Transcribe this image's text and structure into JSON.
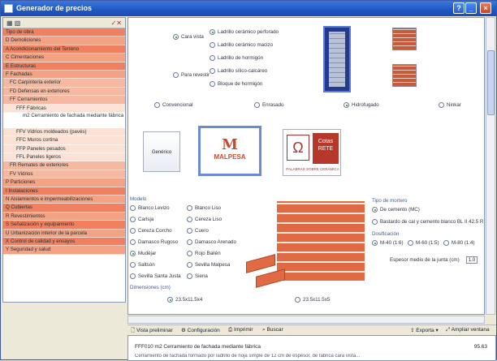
{
  "window": {
    "title": "Generador de precios"
  },
  "left_toolbar": {
    "left": "▦ ▧",
    "right": "✓✕"
  },
  "tree": [
    {
      "label": "Tipo de obra",
      "level": 0
    },
    {
      "label": "D  Demoliciones",
      "level": 0
    },
    {
      "label": "A  Acondicionamiento del Terreno",
      "level": 0
    },
    {
      "label": "C  Cimentaciones",
      "level": 0
    },
    {
      "label": "E  Estructuras",
      "level": 0
    },
    {
      "label": "F  Fachadas",
      "level": 0
    },
    {
      "label": "FC   Carpintería exterior",
      "level": 1
    },
    {
      "label": "FD   Defensas en exteriores",
      "level": 1
    },
    {
      "label": "FF   Cerramientos",
      "level": 1
    },
    {
      "label": "FFF   Fábricas",
      "level": 2
    },
    {
      "label": "m2  Cerramiento de fachada mediante fábrica",
      "level": "sel"
    },
    {
      "label": "FFV   Vidrios moldeados (pavés)",
      "level": 2
    },
    {
      "label": "FFC   Muros cortina",
      "level": 2
    },
    {
      "label": "FFP   Paneles pesados",
      "level": 2
    },
    {
      "label": "FFL   Paneles ligeros",
      "level": 2
    },
    {
      "label": "FR   Remates de exteriores",
      "level": 1
    },
    {
      "label": "FV   Vidrios",
      "level": 1
    },
    {
      "label": "P  Particiones",
      "level": 0
    },
    {
      "label": "I  Instalaciones",
      "level": 0
    },
    {
      "label": "N  Aislamientos e impermeabilizaciones",
      "level": 0
    },
    {
      "label": "Q  Cubiertas",
      "level": 0
    },
    {
      "label": "R  Revestimientos",
      "level": 0
    },
    {
      "label": "S  Señalización y equipamiento",
      "level": 0
    },
    {
      "label": "U  Urbanización interior de la parcela",
      "level": 0
    },
    {
      "label": "X  Control de calidad y ensayos",
      "level": 0
    },
    {
      "label": "Y  Seguridad y salud",
      "level": 0
    }
  ],
  "options_top": {
    "cara_vista": "Cara vista",
    "para_revestir": "Para revestir",
    "ladrillos": [
      "Ladrillo cerámico perforado",
      "Ladrillo cerámico macizo",
      "Ladrillo de hormigón",
      "Ladrillo sílico-calcáreo",
      "Bloque de hormigón"
    ]
  },
  "juntas": [
    "Convencional",
    "Enrasado",
    "Hidrofugado",
    "Ninkar"
  ],
  "logos": {
    "generico": "Genérico",
    "malpesa": "MALPESA",
    "asoc_line1": "Cotas",
    "asoc_line2": "RETE",
    "asoc_bottom": "PALABRAS SOBRE CERÁMICA"
  },
  "modelo": {
    "label": "Modelo",
    "col1": [
      "Blanco Levizo",
      "Carlsja",
      "Cereza Corcho",
      "Damasco Rugoso",
      "Mudéjar",
      "Saltsón",
      "Sevilla Santa Justa"
    ],
    "col2": [
      "Blanco Liso",
      "Cereza Liso",
      "Cuero",
      "Damasco Arenado",
      "Rojo Bailén",
      "Sevilla Malpesa",
      "Siena"
    ]
  },
  "mortero": {
    "label": "Tipo de mortero",
    "options": [
      "De cemento (MC)",
      "Bastardo de cal y cemento blanco BL II 42.5 R"
    ]
  },
  "dosificacion": {
    "label": "Dosificación",
    "options": [
      "M-40 (1:6)",
      "M-60 (1:5)",
      "M-80 (1:4)"
    ],
    "espesor_label": "Espesor medio de la junta (cm)",
    "espesor_value": "1.0"
  },
  "dimensiones": {
    "label": "Dimensiones (cm)",
    "options": [
      "23.5x11.5x4",
      "23.5x11.5x5"
    ]
  },
  "bottom_toolbar": {
    "preview": "Vista preliminar",
    "config": "Configuración",
    "print": "Imprimir",
    "search": "Buscar",
    "export": "Exporta ▾",
    "expand": "Ampliar ventana"
  },
  "footer": {
    "code": "FFF010   m2  Cerramiento de fachada mediante fábrica",
    "price": "95.63",
    "desc": "Cerramiento de fachada formado por ladrillo de hoja simple de 12 cm de espesor, de fábrica cara vista..."
  }
}
